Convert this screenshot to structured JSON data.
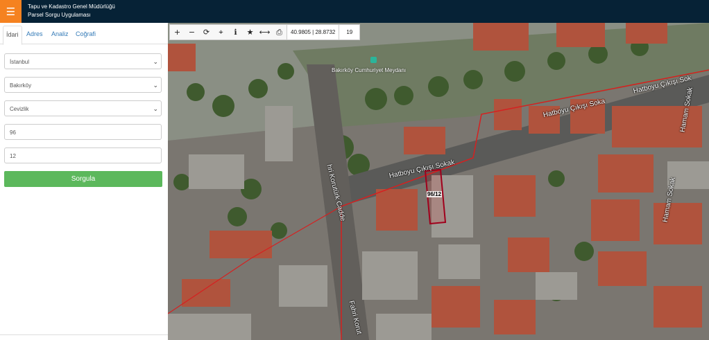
{
  "header": {
    "title_line1": "Tapu ve Kadastro Genel Müdürlüğü",
    "title_line2": "Parsel Sorgu Uygulaması",
    "menu_icon": "hamburger-icon"
  },
  "sidebar": {
    "tabs": [
      {
        "label": "İdari",
        "active": true
      },
      {
        "label": "Adres",
        "active": false
      },
      {
        "label": "Analiz",
        "active": false
      },
      {
        "label": "Coğrafi",
        "active": false
      }
    ],
    "province": "İstanbul",
    "district": "Bakırköy",
    "neighborhood": "Cevizlik",
    "block": "96",
    "parcel": "12",
    "query_button": "Sorgula"
  },
  "map": {
    "toolbar": {
      "coordinates": "40.9805 | 28.8732",
      "zoom": "19"
    },
    "labels": {
      "poi": "Bakırköy Cumhuriyet Meydanı",
      "street_1": "Hatboyu Çıkışı Soka",
      "street_2": "Hatboyu Çıkışı Sokak",
      "street_3": "Hatboyu Çıkışı Sok",
      "street_4": "Hamam Sokak",
      "street_5": "Hamam Sokak",
      "street_6": "hri Korutürk Cadde",
      "street_7": "Fahri Korut",
      "parcel": "96/12"
    },
    "parcel_color": "#cc0000"
  }
}
